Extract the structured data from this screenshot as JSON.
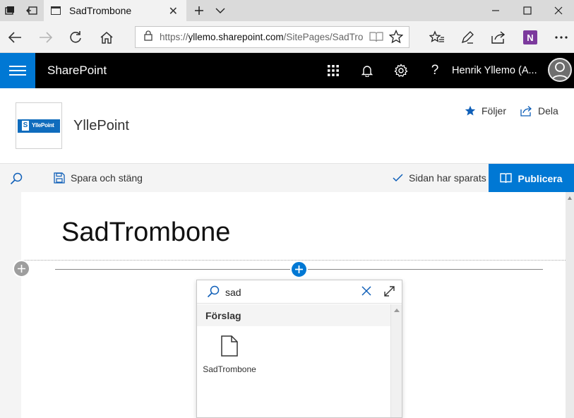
{
  "browser": {
    "tab_title": "SadTrombone",
    "url_prefix": "https://",
    "url_host": "yllemo.sharepoint.com",
    "url_path": "/SitePages/SadTro"
  },
  "suite": {
    "brand": "SharePoint",
    "user_name": "Henrik Yllemo (A...",
    "help_glyph": "?"
  },
  "site": {
    "logo_text": "YllePoint",
    "logo_letter": "S",
    "title": "YllePoint",
    "follow_label": "Följer",
    "share_label": "Dela"
  },
  "commandbar": {
    "save_close_label": "Spara och stäng",
    "saved_status": "Sidan har sparats",
    "publish_label": "Publicera"
  },
  "page": {
    "title": "SadTrombone"
  },
  "toolbox": {
    "search_value": "sad",
    "section_header": "Förslag",
    "items": [
      {
        "label": "SadTrombone"
      }
    ]
  },
  "colors": {
    "accent": "#0078d4",
    "suite_bar": "#000000",
    "onenote": "#7c3a9d"
  }
}
